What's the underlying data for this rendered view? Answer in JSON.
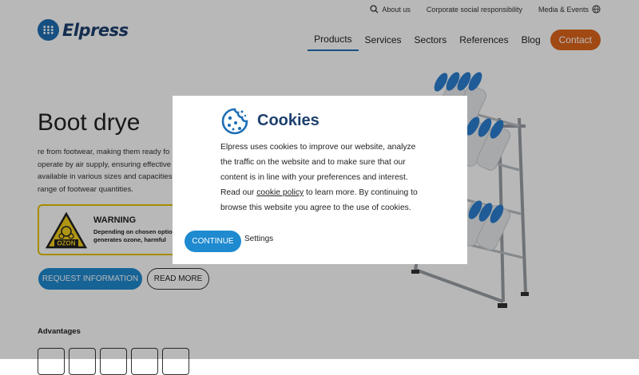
{
  "header": {
    "utility": [
      {
        "label": "About us",
        "icon": "search-icon"
      },
      {
        "label": "Corporate social responsibility"
      },
      {
        "label": "Media & Events",
        "icon": "globe-icon"
      }
    ],
    "brand": "Elpress",
    "nav": [
      "Products",
      "Services",
      "Sectors",
      "References",
      "Blog"
    ],
    "contact": "Contact",
    "accent": "#e0661b",
    "brand_blue": "#1f6fb5"
  },
  "hero": {
    "title": "Boot drye",
    "lines": [
      "re from footwear, making them ready fo",
      "operate by air supply, ensuring effective",
      "available in various sizes and capacities",
      "range of footwear quantities."
    ],
    "warning": {
      "title": "WARNING",
      "line1": "Depending on chosen optio",
      "line2": "generates ozone, harmful",
      "badge": "OZON"
    },
    "request_button": "REQUEST INFORMATION",
    "more_button": "READ MORE"
  },
  "advantages": {
    "title": "Advantages"
  },
  "cookie": {
    "title": "Cookies",
    "lines": [
      "Elpress uses cookies to improve our website, analyze",
      "the traffic on the website and to make sure that our",
      "content is in line with your preferences and interest."
    ],
    "line4_pre": "Read our ",
    "line4_link": "cookie policy",
    "line4_post": " to learn more. By continuing to",
    "line5": "browse this website you agree to the use of cookies.",
    "continue": "CONTINUE",
    "settings": "Settings"
  }
}
